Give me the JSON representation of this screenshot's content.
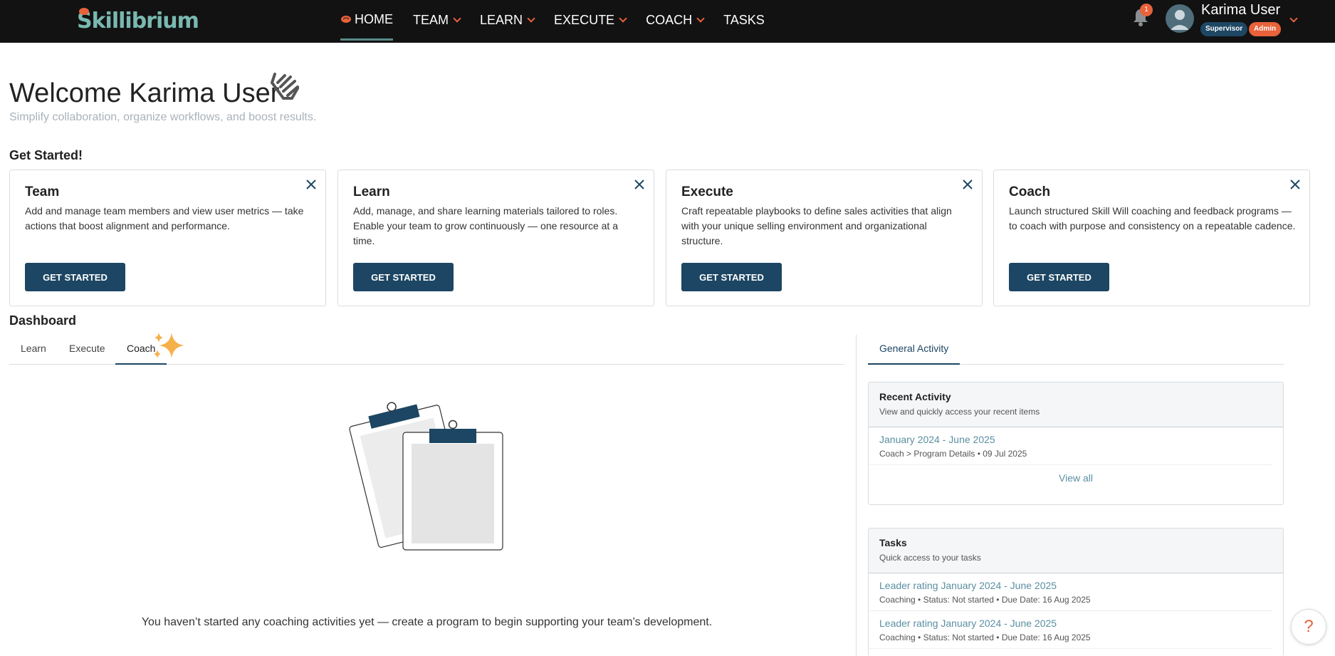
{
  "brand": {
    "name": "Skillibrium"
  },
  "nav": {
    "items": [
      {
        "label": "HOME",
        "has_menu": false
      },
      {
        "label": "TEAM",
        "has_menu": true
      },
      {
        "label": "LEARN",
        "has_menu": true
      },
      {
        "label": "EXECUTE",
        "has_menu": true
      },
      {
        "label": "COACH",
        "has_menu": true
      },
      {
        "label": "TASKS",
        "has_menu": false
      }
    ]
  },
  "user": {
    "name": "Karima User",
    "notifications": "1",
    "roles": [
      "Supervisor",
      "Admin"
    ]
  },
  "welcome": {
    "title": "Welcome Karima User",
    "subtitle": "Simplify collaboration, organize workflows, and boost results."
  },
  "get_started": {
    "heading": "Get Started!",
    "cards": [
      {
        "title": "Team",
        "desc": "Add and manage team members and view user metrics —  take actions that boost alignment and performance.",
        "button": "GET STARTED"
      },
      {
        "title": "Learn",
        "desc": "Add, manage, and share learning materials tailored to roles. Enable your team to grow continuously — one resource at a time.",
        "button": "GET STARTED"
      },
      {
        "title": "Execute",
        "desc": "Craft repeatable playbooks to define sales activities that align with your unique selling environment and organizational structure.",
        "button": "GET STARTED"
      },
      {
        "title": "Coach",
        "desc": "Launch structured Skill Will coaching and feedback programs — to coach with purpose and consistency on a repeatable cadence.",
        "button": "GET STARTED"
      }
    ]
  },
  "dashboard": {
    "heading": "Dashboard",
    "tabs": [
      "Learn",
      "Execute",
      "Coach"
    ],
    "active_tab": "Coach",
    "empty_message": "You haven’t started any coaching activities yet — create a program to begin supporting your team’s development."
  },
  "activity": {
    "tab": "General Activity",
    "recent": {
      "title": "Recent Activity",
      "subtitle": "View and quickly access your recent items",
      "items": [
        {
          "title": "January 2024 - June 2025",
          "meta": "Coach > Program Details • 09 Jul 2025"
        }
      ],
      "view_all": "View all"
    },
    "tasks": {
      "title": "Tasks",
      "subtitle": "Quick access to your tasks",
      "items": [
        {
          "title": "Leader rating January 2024 - June 2025",
          "meta": "Coaching • Status: Not started • Due Date: 16 Aug 2025"
        },
        {
          "title": "Leader rating January 2024 - June 2025",
          "meta": "Coaching • Status: Not started • Due Date: 16 Aug 2025"
        }
      ]
    }
  },
  "help": {
    "label": "?"
  },
  "colors": {
    "navbar": "#121212",
    "brand_teal": "#7ab8b0",
    "accent_orange": "#e8623a",
    "primary_navy": "#1c4663",
    "link": "#5a8fa1"
  }
}
